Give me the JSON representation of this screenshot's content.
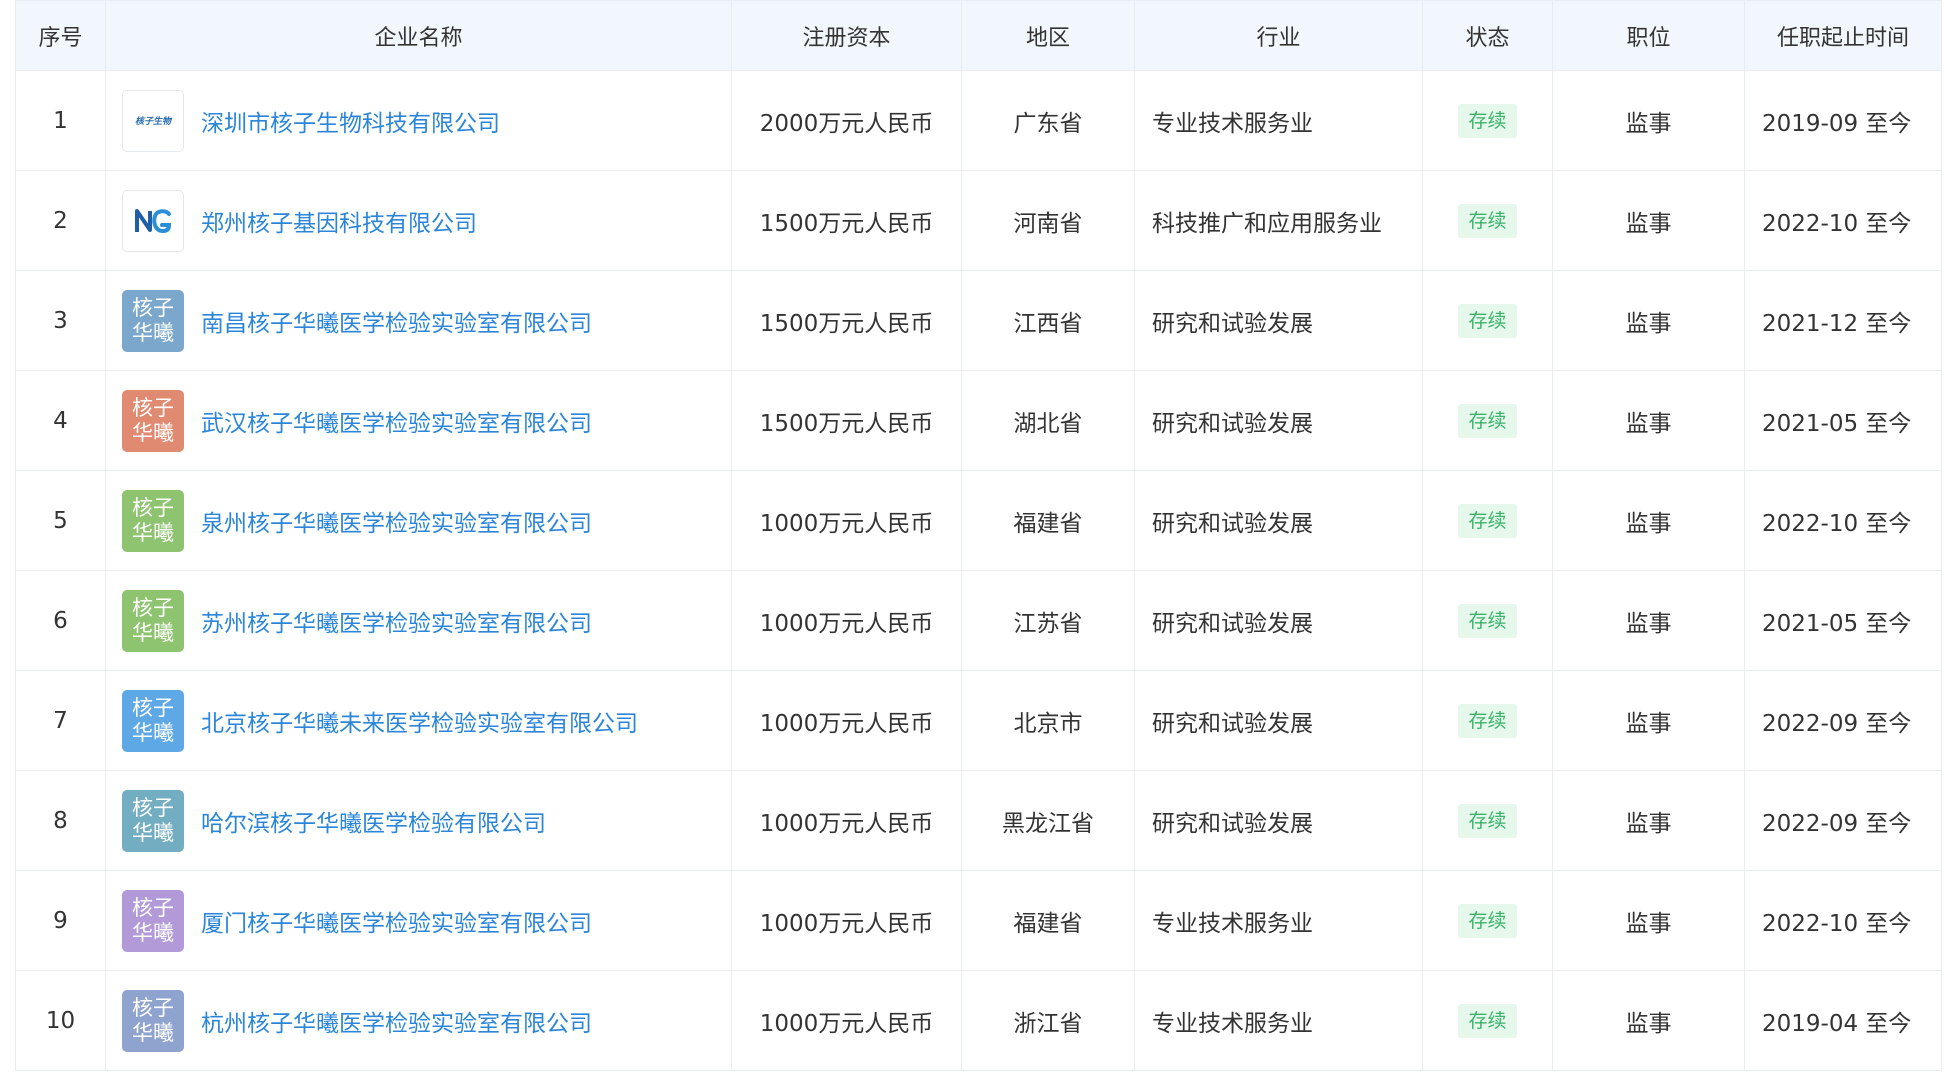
{
  "headers": {
    "index": "序号",
    "company": "企业名称",
    "capital": "注册资本",
    "region": "地区",
    "industry": "行业",
    "status": "状态",
    "position": "职位",
    "term": "任职起止时间"
  },
  "rows": [
    {
      "index": "1",
      "logo_text": "核子生物",
      "logo_style": "outline-text",
      "logo_color": "#ffffff",
      "company": "深圳市核子生物科技有限公司",
      "capital": "2000万元人民币",
      "region": "广东省",
      "industry": "专业技术服务业",
      "status": "存续",
      "position": "监事",
      "term": "2019-09 至今"
    },
    {
      "index": "2",
      "logo_text": "",
      "logo_style": "outline-ng",
      "logo_color": "#ffffff",
      "company": "郑州核子基因科技有限公司",
      "capital": "1500万元人民币",
      "region": "河南省",
      "industry": "科技推广和应用服务业",
      "status": "存续",
      "position": "监事",
      "term": "2022-10 至今"
    },
    {
      "index": "3",
      "logo_text": "核子华曦",
      "logo_style": "filled",
      "logo_color": "#7ba7cd",
      "company": "南昌核子华曦医学检验实验室有限公司",
      "capital": "1500万元人民币",
      "region": "江西省",
      "industry": "研究和试验发展",
      "status": "存续",
      "position": "监事",
      "term": "2021-12 至今"
    },
    {
      "index": "4",
      "logo_text": "核子华曦",
      "logo_style": "filled",
      "logo_color": "#e08a72",
      "company": "武汉核子华曦医学检验实验室有限公司",
      "capital": "1500万元人民币",
      "region": "湖北省",
      "industry": "研究和试验发展",
      "status": "存续",
      "position": "监事",
      "term": "2021-05 至今"
    },
    {
      "index": "5",
      "logo_text": "核子华曦",
      "logo_style": "filled",
      "logo_color": "#8ec46f",
      "company": "泉州核子华曦医学检验实验室有限公司",
      "capital": "1000万元人民币",
      "region": "福建省",
      "industry": "研究和试验发展",
      "status": "存续",
      "position": "监事",
      "term": "2022-10 至今"
    },
    {
      "index": "6",
      "logo_text": "核子华曦",
      "logo_style": "filled",
      "logo_color": "#8ec46f",
      "company": "苏州核子华曦医学检验实验室有限公司",
      "capital": "1000万元人民币",
      "region": "江苏省",
      "industry": "研究和试验发展",
      "status": "存续",
      "position": "监事",
      "term": "2021-05 至今"
    },
    {
      "index": "7",
      "logo_text": "核子华曦",
      "logo_style": "filled",
      "logo_color": "#5ea8e6",
      "company": "北京核子华曦未来医学检验实验室有限公司",
      "capital": "1000万元人民币",
      "region": "北京市",
      "industry": "研究和试验发展",
      "status": "存续",
      "position": "监事",
      "term": "2022-09 至今"
    },
    {
      "index": "8",
      "logo_text": "核子华曦",
      "logo_style": "filled",
      "logo_color": "#73adc2",
      "company": "哈尔滨核子华曦医学检验有限公司",
      "capital": "1000万元人民币",
      "region": "黑龙江省",
      "industry": "研究和试验发展",
      "status": "存续",
      "position": "监事",
      "term": "2022-09 至今"
    },
    {
      "index": "9",
      "logo_text": "核子华曦",
      "logo_style": "filled",
      "logo_color": "#b29ad9",
      "company": "厦门核子华曦医学检验实验室有限公司",
      "capital": "1000万元人民币",
      "region": "福建省",
      "industry": "专业技术服务业",
      "status": "存续",
      "position": "监事",
      "term": "2022-10 至今"
    },
    {
      "index": "10",
      "logo_text": "核子华曦",
      "logo_style": "filled",
      "logo_color": "#8fa3cf",
      "company": "杭州核子华曦医学检验实验室有限公司",
      "capital": "1000万元人民币",
      "region": "浙江省",
      "industry": "专业技术服务业",
      "status": "存续",
      "position": "监事",
      "term": "2019-04 至今"
    }
  ]
}
